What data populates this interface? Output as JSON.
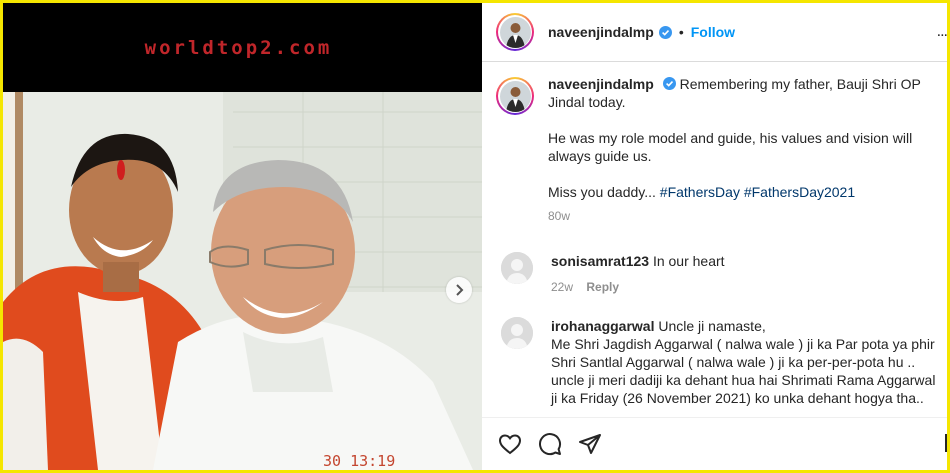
{
  "watermark": "worldtop2.com",
  "photo_stamp": "30  13:19",
  "header": {
    "username": "naveenjindalmp",
    "separator": "•",
    "follow_label": "Follow",
    "more_label": "..."
  },
  "caption": {
    "username": "naveenjindalmp",
    "line1": "Remembering my father, Bauji Shri OP Jindal today.",
    "line2": "He was my role model and guide, his values and vision will always guide us.",
    "line3_prefix": "Miss you daddy...",
    "hashtags": [
      "#FathersDay",
      "#FathersDay2021"
    ],
    "age": "80w"
  },
  "comments": [
    {
      "username": "sonisamrat123",
      "text": "In our heart",
      "age": "22w",
      "reply_label": "Reply"
    },
    {
      "username": "irohanaggarwal",
      "text": "Uncle ji namaste,\nMe Shri Jagdish Aggarwal ( nalwa wale ) ji ka Par pota ya phir Shri Santlal Aggarwal ( nalwa wale ) ji ka per-per-pota hu .. uncle ji meri dadiji ka dehant hua hai Shrimati Rama Aggarwal ji ka Friday (26 November 2021) ko unka dehant hogya tha.."
    }
  ],
  "icons": {
    "verified": "verified-badge-icon",
    "like": "heart-icon",
    "comment": "comment-bubble-icon",
    "share": "paper-plane-icon",
    "next": "chevron-right-icon"
  },
  "colors": {
    "background_border": "#f5e600",
    "accent": "#0095f6",
    "hashtag": "#00376b",
    "watermark": "#c0262a"
  }
}
